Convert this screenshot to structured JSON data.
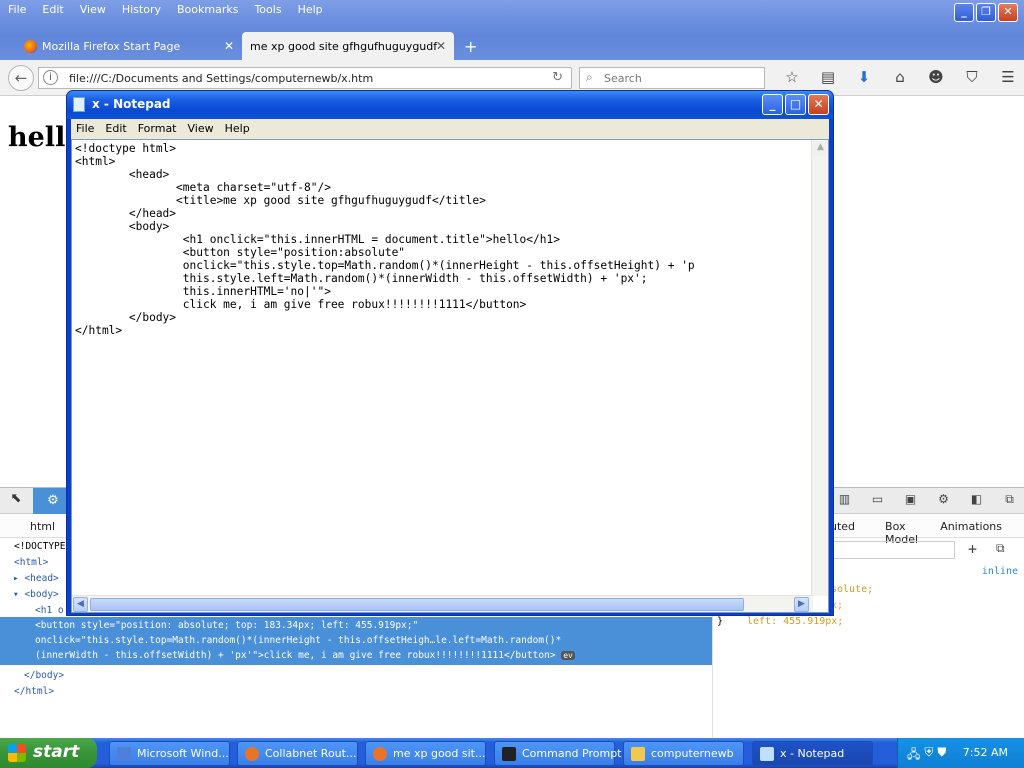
{
  "firefox": {
    "menu": [
      "File",
      "Edit",
      "View",
      "History",
      "Bookmarks",
      "Tools",
      "Help"
    ],
    "tabs": [
      {
        "label": "Mozilla Firefox Start Page"
      },
      {
        "label": "me xp good site gfhgufhuguygudf"
      }
    ],
    "url": "file:///C:/Documents and Settings/computernewb/x.htm",
    "search_placeholder": "Search",
    "page_heading": "hello"
  },
  "devtools": {
    "breadcrumb": "html",
    "side_tabs": [
      "uted",
      "Box Model",
      "Animations"
    ],
    "markup_lines": [
      "<!DOCTYPE",
      "<html>",
      "<head>",
      "<body>",
      "<h1 o"
    ],
    "selected_lines": [
      "<button style=\"position: absolute; top: 183.34px; left: 455.919px;\"",
      "onclick=\"this.style.top=Math.random()*(innerHeight - this.offsetHeigh…le.left=Math.random()*",
      "(innerWidth - this.offsetWidth) + 'px'\">click me, i am give free robux!!!!!!!!1111</button>"
    ],
    "event_badge": "ev",
    "closing_lines": [
      "</body>",
      "</html>"
    ],
    "rules": {
      "inline_label": "inline",
      "line1": "solute;",
      "line2": "x;",
      "line3": "left: 455.919px;",
      "brace": "}"
    }
  },
  "notepad": {
    "title": "x - Notepad",
    "menu": [
      "File",
      "Edit",
      "Format",
      "View",
      "Help"
    ],
    "content": "<!doctype html>\n<html>\n        <head>\n               <meta charset=\"utf-8\"/>\n               <title>me xp good site gfhgufhuguygudf</title>\n        </head>\n        <body>\n                <h1 onclick=\"this.innerHTML = document.title\">hello</h1>\n                <button style=\"position:absolute\"\n                onclick=\"this.style.top=Math.random()*(innerHeight - this.offsetHeight) + 'p\n                this.style.left=Math.random()*(innerWidth - this.offsetWidth) + 'px';\n                this.innerHTML='no|'\">\n                click me, i am give free robux!!!!!!!!1111</button>\n        </body>\n</html>"
  },
  "taskbar": {
    "start": "start",
    "tasks": [
      {
        "label": "Microsoft Wind...",
        "color": "#4f7fd8"
      },
      {
        "label": "Collabnet Rout...",
        "color": "#e8742a"
      },
      {
        "label": "me xp good sit...",
        "color": "#e8742a"
      },
      {
        "label": "Command Prompt",
        "color": "#222222"
      },
      {
        "label": "computernewb",
        "color": "#f2c94c"
      },
      {
        "label": "x - Notepad",
        "color": "#bfe0ff"
      }
    ],
    "clock": "7:52 AM"
  }
}
